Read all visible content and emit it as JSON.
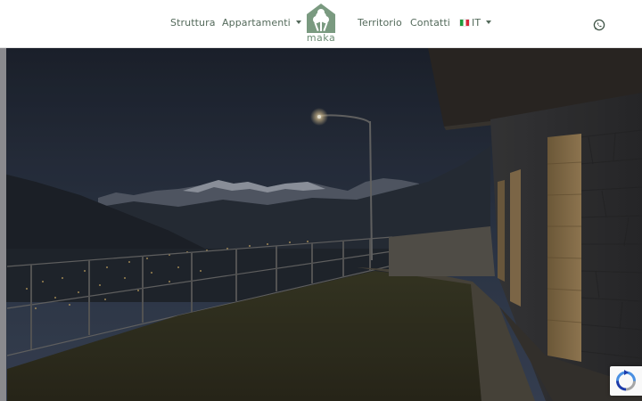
{
  "header": {
    "nav_left": [
      {
        "label": "Struttura"
      },
      {
        "label": "Appartamenti"
      }
    ],
    "nav_right": [
      {
        "label": "Territorio"
      },
      {
        "label": "Contatti"
      }
    ],
    "language": {
      "label": "IT"
    },
    "logo": {
      "text": "maka",
      "icon": "tree-house-logo"
    },
    "contact_icon": "whatsapp-icon"
  },
  "hero": {
    "image": "night-mountain-terrace-photo"
  },
  "widgets": {
    "captcha_icon": "recaptcha-icon"
  },
  "colors": {
    "nav_text": "#546a5b",
    "logo_green": "#6a8b72",
    "header_bg": "#ffffff"
  }
}
